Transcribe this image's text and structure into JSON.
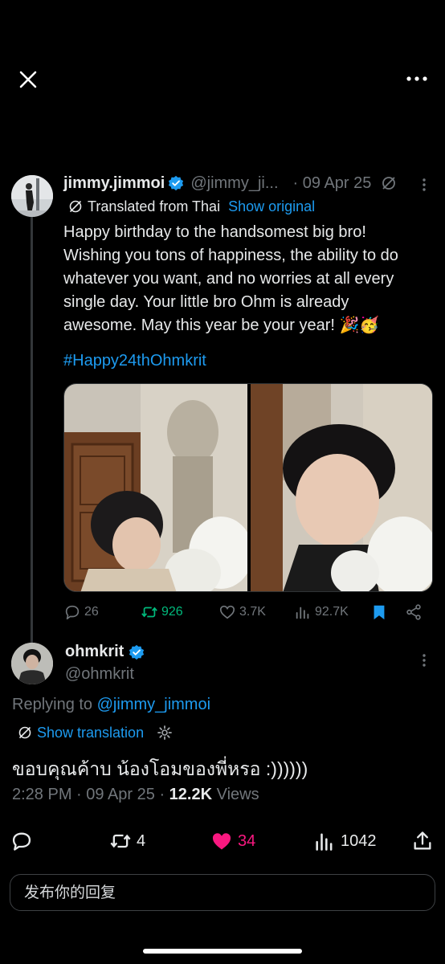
{
  "tweet": {
    "display_name": "jimmy.jimmoi",
    "handle": "@jimmy_ji...",
    "date": "· 09 Apr 25",
    "translated_label": "Translated from Thai",
    "show_original": "Show original",
    "text": "Happy birthday to the handsomest big bro! Wishing you tons of happiness, the ability to do whatever you want, and no worries at all every single day. Your little bro Ohm is already awesome. May this year be your year! 🎉🥳",
    "hashtag": "#Happy24thOhmkrit",
    "stats": {
      "replies": "26",
      "reposts": "926",
      "likes": "3.7K",
      "views": "92.7K"
    },
    "colors": {
      "repost_active": "#00ba7c",
      "bookmark_active": "#1d9bf0"
    }
  },
  "reply": {
    "display_name": "ohmkrit",
    "handle": "@ohmkrit",
    "replying_prefix": "Replying to",
    "replying_to": "@jimmy_jimmoi",
    "show_translation": "Show translation",
    "text": "ขอบคุณค้าบ น้องโอมของพี่หรอ :))))))",
    "time": "2:28 PM",
    "date": "09 Apr 25",
    "views_count": "12.2K",
    "views_label": "Views",
    "stats": {
      "reposts": "4",
      "likes": "34",
      "views": "1042"
    },
    "colors": {
      "like_active": "#f91880"
    }
  },
  "composer": {
    "placeholder": "发布你的回复"
  },
  "icons": [
    "close-icon",
    "more-icon",
    "verified-icon",
    "edit-icon",
    "translate-icon",
    "reply-icon",
    "repost-icon",
    "like-icon",
    "views-icon",
    "bookmark-icon",
    "share-icon",
    "gear-icon"
  ],
  "theme": {
    "background": "#000000",
    "accent": "#1d9bf0"
  }
}
